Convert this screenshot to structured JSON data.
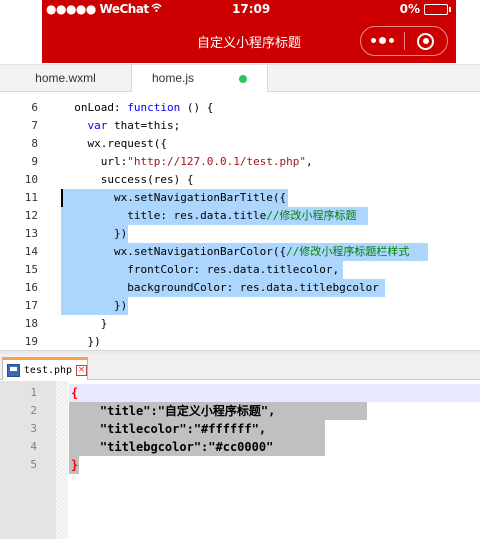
{
  "phone": {
    "carrier": "●●●●● WeChat",
    "time": "17:09",
    "battery": "0%",
    "nav_title": "自定义小程序标题",
    "accent": "#cc0000"
  },
  "editor_tabs": [
    "home.wxml",
    "home.js"
  ],
  "top_editor": {
    "lines": [
      {
        "n": "6",
        "segs": [
          [
            "pl",
            "  onLoad: "
          ],
          [
            "kw",
            "function"
          ],
          [
            "pl",
            " () {"
          ]
        ]
      },
      {
        "n": "7",
        "segs": [
          [
            "pl",
            "    "
          ],
          [
            "kw",
            "var"
          ],
          [
            "pl",
            " that=this;"
          ]
        ]
      },
      {
        "n": "8",
        "segs": [
          [
            "pl",
            "    wx.request({"
          ]
        ]
      },
      {
        "n": "9",
        "segs": [
          [
            "pl",
            "      url:"
          ],
          [
            "str",
            "\"http://127.0.0.1/test.php\""
          ],
          [
            "pl",
            ","
          ]
        ]
      },
      {
        "n": "10",
        "segs": [
          [
            "pl",
            "      success(res) {"
          ]
        ]
      },
      {
        "n": "11",
        "segs": [
          [
            "pl",
            "        wx.setNavigationBarTitle({"
          ]
        ]
      },
      {
        "n": "12",
        "segs": [
          [
            "pl",
            "          title: res.data.title"
          ],
          [
            "cmt",
            "//修改小程序标题"
          ]
        ]
      },
      {
        "n": "13",
        "segs": [
          [
            "pl",
            "        })"
          ]
        ]
      },
      {
        "n": "14",
        "segs": [
          [
            "pl",
            "        wx.setNavigationBarColor({"
          ],
          [
            "cmt",
            "//修改小程序标题栏样式"
          ]
        ]
      },
      {
        "n": "15",
        "segs": [
          [
            "pl",
            "          frontColor: res.data.titlecolor,"
          ]
        ]
      },
      {
        "n": "16",
        "segs": [
          [
            "pl",
            "          backgroundColor: res.data.titlebgcolor"
          ]
        ]
      },
      {
        "n": "17",
        "segs": [
          [
            "pl",
            "        })"
          ]
        ]
      },
      {
        "n": "18",
        "segs": [
          [
            "pl",
            "      }"
          ]
        ]
      },
      {
        "n": "19",
        "segs": [
          [
            "pl",
            "    })"
          ]
        ]
      }
    ]
  },
  "php_tab": {
    "filename": "test.php",
    "close_glyph": "×"
  },
  "bottom_editor": {
    "lines": [
      {
        "n": "1",
        "segs": [
          [
            "br",
            "{"
          ]
        ]
      },
      {
        "n": "2",
        "segs": [
          [
            "pl",
            "    \"title\":\"自定义小程序标题\","
          ]
        ]
      },
      {
        "n": "3",
        "segs": [
          [
            "pl",
            "    \"titlecolor\":\"#ffffff\","
          ]
        ]
      },
      {
        "n": "4",
        "segs": [
          [
            "pl",
            "    \"titlebgcolor\":\"#cc0000\""
          ]
        ]
      },
      {
        "n": "5",
        "segs": [
          [
            "br",
            "}"
          ]
        ]
      }
    ]
  }
}
